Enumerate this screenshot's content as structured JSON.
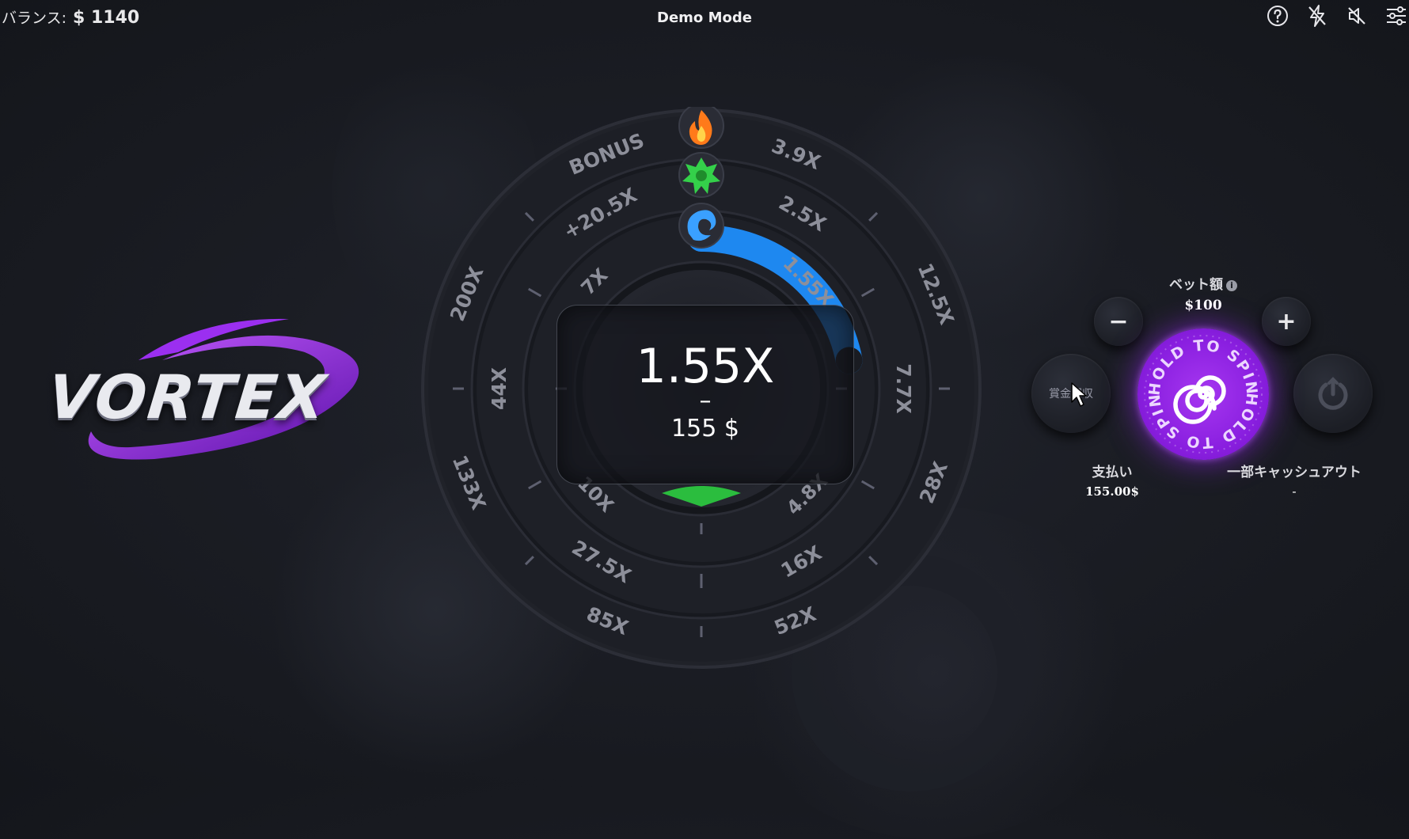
{
  "topbar": {
    "balance_label": "バランス:",
    "balance_value": "$ 1140",
    "mode": "Demo Mode",
    "icons": [
      "help-icon",
      "turbo-off-icon",
      "sound-off-icon",
      "settings-icon"
    ]
  },
  "logo": {
    "text": "VORTEX"
  },
  "wheel": {
    "outer_ring": [
      "3.9X",
      "12.5X",
      "28X",
      "52X",
      "85X",
      "133X",
      "200X",
      "BONUS"
    ],
    "middle_ring": [
      "2.5X",
      "7.7X",
      "16X",
      "27.5X",
      "44X",
      "+20.5X"
    ],
    "inner_ring": [
      "1.55X",
      "4.8X",
      "10X",
      "7X"
    ],
    "markers": [
      "fire-icon",
      "leaf-icon",
      "water-icon"
    ],
    "progress_fraction": 0.22,
    "accent_color": "#1e88f0"
  },
  "center": {
    "multiplier": "1.55X",
    "dash": "–",
    "amount": "155 $"
  },
  "controls": {
    "bet_label": "ベット額",
    "bet_value": "$100",
    "minus": "−",
    "plus": "+",
    "collect_label": "賞金回収",
    "spin_text_top": "HOLD TO SPIN",
    "spin_text_bottom": "HOLD TO SPIN",
    "payout_label": "支払い",
    "payout_value": "155.00$",
    "partial_cashout_label": "一部キャッシュアウト",
    "partial_cashout_value": "-"
  },
  "colors": {
    "spin_button": "#9b2ff0",
    "progress_arc": "#1e88f0"
  }
}
